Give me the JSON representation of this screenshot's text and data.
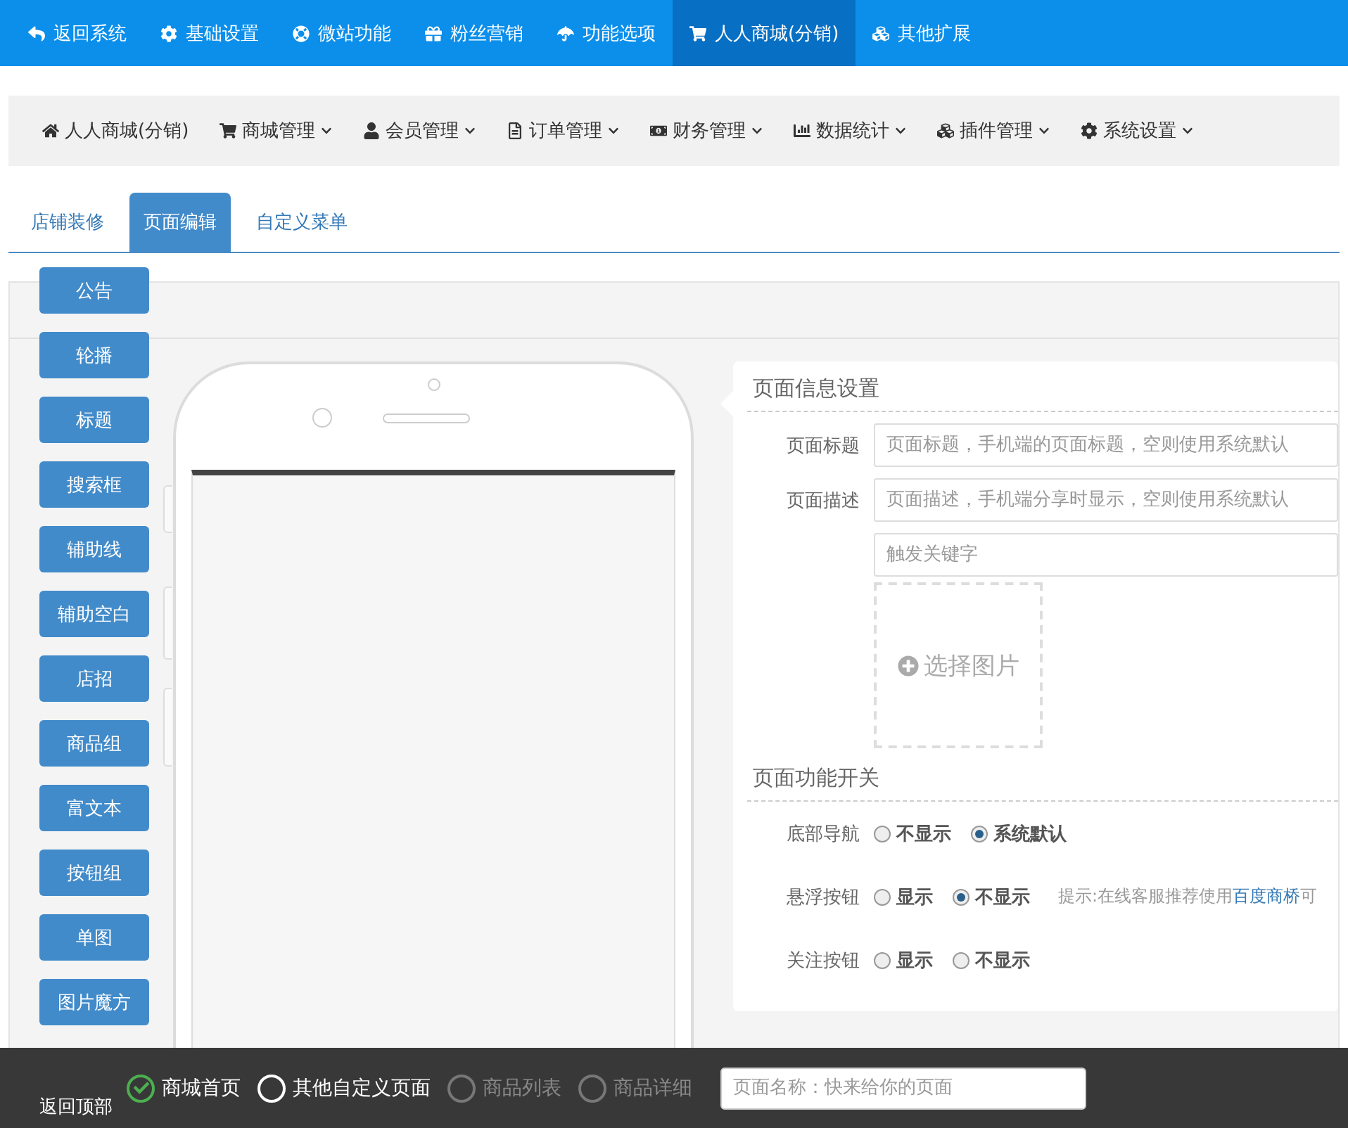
{
  "top_nav": [
    {
      "label": "返回系统",
      "selected": false
    },
    {
      "label": "基础设置",
      "selected": false
    },
    {
      "label": "微站功能",
      "selected": false
    },
    {
      "label": "粉丝营销",
      "selected": false
    },
    {
      "label": "功能选项",
      "selected": false
    },
    {
      "label": "人人商城(分销)",
      "selected": true
    },
    {
      "label": "其他扩展",
      "selected": false
    }
  ],
  "sub_nav": [
    {
      "label": "人人商城(分销)",
      "dropdown": false
    },
    {
      "label": "商城管理",
      "dropdown": true
    },
    {
      "label": "会员管理",
      "dropdown": true
    },
    {
      "label": "订单管理",
      "dropdown": true
    },
    {
      "label": "财务管理",
      "dropdown": true
    },
    {
      "label": "数据统计",
      "dropdown": true
    },
    {
      "label": "插件管理",
      "dropdown": true
    },
    {
      "label": "系统设置",
      "dropdown": true
    }
  ],
  "tabs": [
    {
      "label": "店铺装修",
      "selected": false
    },
    {
      "label": "页面编辑",
      "selected": true
    },
    {
      "label": "自定义菜单",
      "selected": false
    }
  ],
  "components": [
    "公告",
    "轮播",
    "标题",
    "搜索框",
    "辅助线",
    "辅助空白",
    "店招",
    "商品组",
    "富文本",
    "按钮组",
    "单图",
    "图片魔方"
  ],
  "info": {
    "title": "页面信息设置",
    "fields": [
      {
        "label": "页面标题",
        "placeholder": "页面标题，手机端的页面标题，空则使用系统默认"
      },
      {
        "label": "页面描述",
        "placeholder": "页面描述，手机端分享时显示，空则使用系统默认"
      },
      {
        "placeholder": "触发关键字"
      }
    ],
    "image_picker": "选择图片"
  },
  "switches": {
    "title": "页面功能开关",
    "rows": [
      {
        "label": "底部导航",
        "options": [
          {
            "label": "不显示",
            "selected": false
          },
          {
            "label": "系统默认",
            "selected": true
          }
        ]
      },
      {
        "label": "悬浮按钮",
        "options": [
          {
            "label": "显示",
            "selected": false
          },
          {
            "label": "不显示",
            "selected": true
          }
        ],
        "hint": {
          "text": "提示:在线客服推荐使用",
          "link": "百度商桥",
          "after": "可"
        }
      },
      {
        "label": "关注按钮",
        "options": [
          {
            "label": "显示",
            "selected": false
          },
          {
            "label": "不显示",
            "selected": false
          }
        ]
      }
    ]
  },
  "bottom_bar": {
    "back_to_top": "返回顶部",
    "page_types": [
      {
        "label": "商城首页",
        "selected": true,
        "disabled": false
      },
      {
        "label": "其他自定义页面",
        "selected": false,
        "disabled": false
      },
      {
        "label": "商品列表",
        "selected": false,
        "disabled": true
      },
      {
        "label": "商品详细",
        "selected": false,
        "disabled": true
      }
    ],
    "name_field": {
      "placeholder": "页面名称：快来给你的页面"
    }
  }
}
